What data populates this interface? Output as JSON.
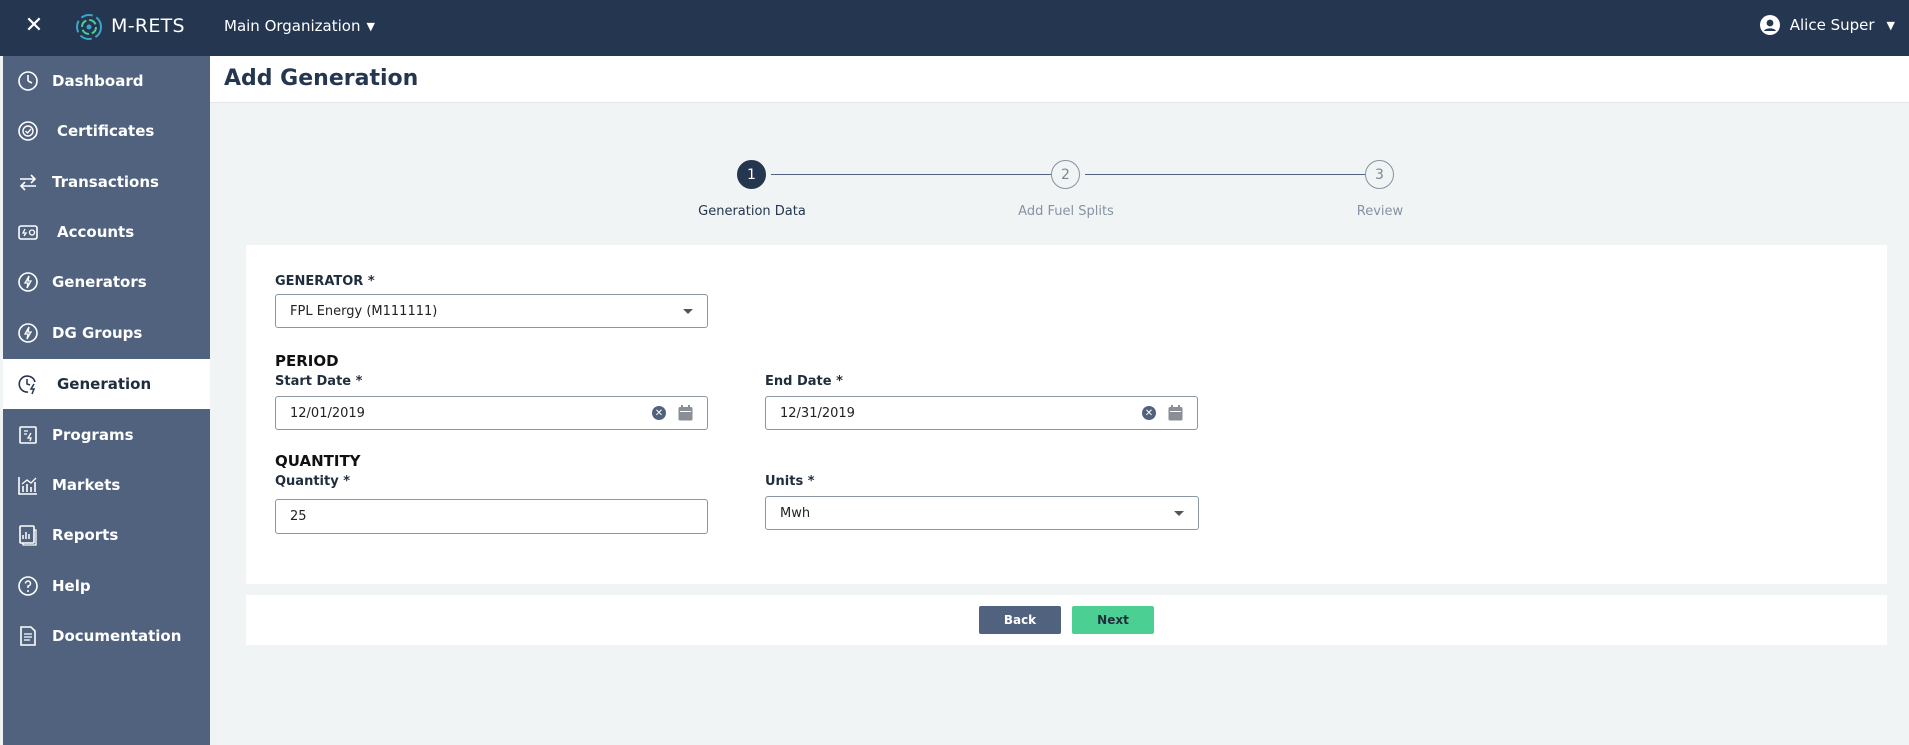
{
  "topbar": {
    "brand": "M-RETS",
    "organization": "Main Organization",
    "user_name": "Alice Super"
  },
  "sidebar": {
    "items": [
      {
        "label": "Dashboard",
        "icon": "dashboard-icon"
      },
      {
        "label": "Certificates",
        "icon": "certificate-icon"
      },
      {
        "label": "Transactions",
        "icon": "transfer-arrows-icon"
      },
      {
        "label": "Accounts",
        "icon": "accounts-icon"
      },
      {
        "label": "Generators",
        "icon": "lightning-icon"
      },
      {
        "label": "DG Groups",
        "icon": "lightning-icon"
      },
      {
        "label": "Generation",
        "icon": "clock-lightning-icon",
        "active": true
      },
      {
        "label": "Programs",
        "icon": "programs-icon"
      },
      {
        "label": "Markets",
        "icon": "chart-icon"
      },
      {
        "label": "Reports",
        "icon": "report-icon"
      },
      {
        "label": "Help",
        "icon": "help-icon"
      },
      {
        "label": "Documentation",
        "icon": "document-icon"
      }
    ]
  },
  "page": {
    "title": "Add Generation"
  },
  "stepper": {
    "steps": [
      {
        "number": "1",
        "label": "Generation Data",
        "active": true
      },
      {
        "number": "2",
        "label": "Add Fuel Splits",
        "active": false
      },
      {
        "number": "3",
        "label": "Review",
        "active": false
      }
    ]
  },
  "form": {
    "generator_label": "GENERATOR *",
    "generator_value": "FPL Energy (M111111)",
    "period_title": "PERIOD",
    "start_date_label": "Start Date *",
    "start_date_value": "12/01/2019",
    "end_date_label": "End Date *",
    "end_date_value": "12/31/2019",
    "quantity_title": "QUANTITY",
    "quantity_label": "Quantity  *",
    "quantity_value": "25",
    "units_label": "Units  *",
    "units_value": "Mwh"
  },
  "actions": {
    "back_label": "Back",
    "next_label": "Next"
  },
  "colors": {
    "topbar": "#243650",
    "sidebar": "#50627e",
    "next_button": "#4ccf92",
    "back_button": "#50627e"
  }
}
